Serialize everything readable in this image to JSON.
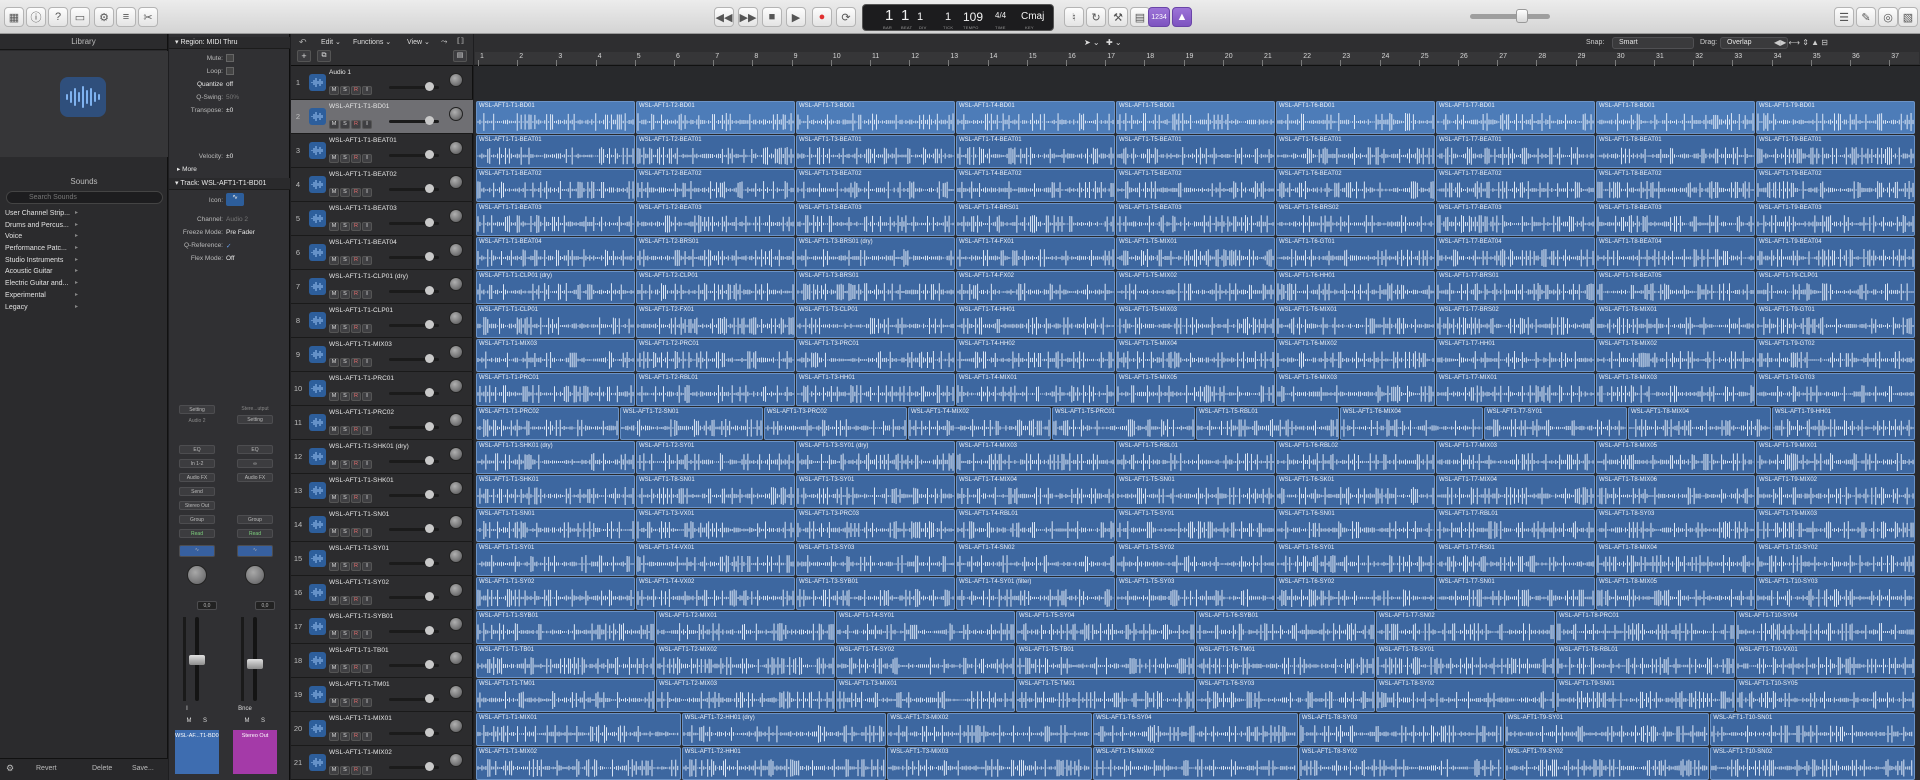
{
  "toolbar": {
    "lcd": {
      "bar": "1",
      "beat": "1",
      "div": "1",
      "tick": "1",
      "bar_lbl": "BAR",
      "beat_lbl": "BEAT",
      "div_lbl": "DIV",
      "tick_lbl": "TICK",
      "tempo": "109",
      "tempo_lbl": "TEMPO",
      "sig": "4/4",
      "sig_lbl": "TIME",
      "key": "Cmaj",
      "key_lbl": "KEY"
    },
    "count_in": "1234"
  },
  "library": {
    "title": "Library",
    "sounds_title": "Sounds",
    "search_placeholder": "Search Sounds",
    "items": [
      "User Channel Strip...",
      "Drums and Percus...",
      "Voice",
      "Performance Patc...",
      "Studio Instruments",
      "Acoustic Guitar",
      "Electric Guitar and...",
      "Experimental",
      "Legacy"
    ],
    "revert": "Revert",
    "delete": "Delete",
    "save": "Save..."
  },
  "inspector": {
    "region_title": "Region: MIDI Thru",
    "mute": "Mute:",
    "loop": "Loop:",
    "quantize": "Quantize",
    "quantize_val": "off",
    "qswing": "Q-Swing:",
    "qswing_val": "50%",
    "transpose": "Transpose:",
    "transpose_val": "±0",
    "velocity": "Velocity:",
    "velocity_val": "±0",
    "more": "More",
    "track_title": "Track:  WSL-AFT1-T1-BD01",
    "icon": "Icon:",
    "channel": "Channel:",
    "channel_val": "Audio 2",
    "freeze": "Freeze Mode:",
    "freeze_val": "Pre Fader",
    "qref": "Q-Reference:",
    "qref_val": "✓",
    "flex": "Flex Mode:",
    "flex_val": "Off",
    "strip1": {
      "setting": "Setting",
      "audio": "Audio 2",
      "eq": "EQ",
      "input": "In 1-2",
      "fx": "Audio FX",
      "send": "Send",
      "out": "Stereo Out",
      "group": "Group",
      "auto": "Read",
      "vol": "0,0",
      "name": "WSL-AF...T1-BD01",
      "btn": "I"
    },
    "strip2": {
      "top": "Stere...utput",
      "setting": "Setting",
      "eq": "EQ",
      "fx": "Audio FX",
      "group": "Group",
      "auto": "Read",
      "vol": "0,0",
      "name": "Stereo Out",
      "btn": "Bnce"
    }
  },
  "arrange": {
    "edit": "Edit",
    "functions": "Functions",
    "view": "View",
    "snap_lbl": "Snap:",
    "snap_val": "Smart",
    "drag_lbl": "Drag:",
    "drag_val": "Overlap",
    "bars": [
      "1",
      "2",
      "3",
      "4",
      "5",
      "6",
      "7",
      "8",
      "9",
      "10",
      "11",
      "12",
      "13",
      "14",
      "15",
      "16",
      "17",
      "18",
      "19",
      "20",
      "21",
      "22",
      "23",
      "24",
      "25",
      "26",
      "27",
      "28",
      "29",
      "30",
      "31",
      "32",
      "33",
      "34",
      "35",
      "36",
      "37"
    ]
  },
  "tracks": [
    {
      "num": "1",
      "name": "Audio 1",
      "regions": []
    },
    {
      "num": "2",
      "name": "WSL-AFT1-T1-BD01",
      "sel": true,
      "regions": [
        "WSL-AFT1-T1-BD01",
        "WSL-AFT1-T2-BD01",
        "WSL-AFT1-T3-BD01",
        "WSL-AFT1-T4-BD01",
        "WSL-AFT1-T5-BD01",
        "WSL-AFT1-T6-BD01",
        "WSL-AFT1-T7-BD01",
        "WSL-AFT1-T8-BD01",
        "WSL-AFT1-T9-BD01"
      ]
    },
    {
      "num": "3",
      "name": "WSL-AFT1-T1-BEAT01",
      "regions": [
        "WSL-AFT1-T1-BEAT01",
        "WSL-AFT1-T2-BEAT01",
        "WSL-AFT1-T3-BEAT01",
        "WSL-AFT1-T4-BEAT01",
        "WSL-AFT1-T5-BEAT01",
        "WSL-AFT1-T6-BEAT01",
        "WSL-AFT1-T7-BEAT01",
        "WSL-AFT1-T8-BEAT01",
        "WSL-AFT1-T9-BEAT01"
      ]
    },
    {
      "num": "4",
      "name": "WSL-AFT1-T1-BEAT02",
      "regions": [
        "WSL-AFT1-T1-BEAT02",
        "WSL-AFT1-T2-BEAT02",
        "WSL-AFT1-T3-BEAT02",
        "WSL-AFT1-T4-BEAT02",
        "WSL-AFT1-T5-BEAT02",
        "WSL-AFT1-T6-BEAT02",
        "WSL-AFT1-T7-BEAT02",
        "WSL-AFT1-T8-BEAT02",
        "WSL-AFT1-T9-BEAT02"
      ]
    },
    {
      "num": "5",
      "name": "WSL-AFT1-T1-BEAT03",
      "regions": [
        "WSL-AFT1-T1-BEAT03",
        "WSL-AFT1-T2-BEAT03",
        "WSL-AFT1-T3-BEAT03",
        "WSL-AFT1-T4-BRS01",
        "WSL-AFT1-T5-BEAT03",
        "WSL-AFT1-T6-BRS02",
        "WSL-AFT1-T7-BEAT03",
        "WSL-AFT1-T8-BEAT03",
        "WSL-AFT1-T9-BEAT03"
      ]
    },
    {
      "num": "6",
      "name": "WSL-AFT1-T1-BEAT04",
      "regions": [
        "WSL-AFT1-T1-BEAT04",
        "WSL-AFT1-T2-BRS01",
        "WSL-AFT1-T3-BRS01 (dry)",
        "WSL-AFT1-T4-FX01",
        "WSL-AFT1-T5-MIX01",
        "WSL-AFT1-T6-GT01",
        "WSL-AFT1-T7-BEAT04",
        "WSL-AFT1-T8-BEAT04",
        "WSL-AFT1-T9-BEAT04"
      ]
    },
    {
      "num": "7",
      "name": "WSL-AFT1-T1-CLP01 (dry)",
      "regions": [
        "WSL-AFT1-T1-CLP01 (dry)",
        "WSL-AFT1-T2-CLP01",
        "WSL-AFT1-T3-BRS01",
        "WSL-AFT1-T4-FX02",
        "WSL-AFT1-T5-MIX02",
        "WSL-AFT1-T6-HH01",
        "WSL-AFT1-T7-BRS01",
        "WSL-AFT1-T8-BEAT05",
        "WSL-AFT1-T9-CLP01"
      ]
    },
    {
      "num": "8",
      "name": "WSL-AFT1-T1-CLP01",
      "regions": [
        "WSL-AFT1-T1-CLP01",
        "WSL-AFT1-T2-FX01",
        "WSL-AFT1-T3-CLP01",
        "WSL-AFT1-T4-HH01",
        "WSL-AFT1-T5-MIX03",
        "WSL-AFT1-T6-MIX01",
        "WSL-AFT1-T7-BRS02",
        "WSL-AFT1-T8-MIX01",
        "WSL-AFT1-T9-GT01"
      ]
    },
    {
      "num": "9",
      "name": "WSL-AFT1-T1-MIX03",
      "regions": [
        "WSL-AFT1-T1-MIX03",
        "WSL-AFT1-T2-PRC01",
        "WSL-AFT1-T3-PRC01",
        "WSL-AFT1-T4-HH02",
        "WSL-AFT1-T5-MIX04",
        "WSL-AFT1-T6-MIX02",
        "WSL-AFT1-T7-HH01",
        "WSL-AFT1-T8-MIX02",
        "WSL-AFT1-T9-GT02"
      ]
    },
    {
      "num": "10",
      "name": "WSL-AFT1-T1-PRC01",
      "regions": [
        "WSL-AFT1-T1-PRC01",
        "WSL-AFT1-T2-RBL01",
        "WSL-AFT1-T3-HH01",
        "WSL-AFT1-T4-MIX01",
        "WSL-AFT1-T5-MIX05",
        "WSL-AFT1-T6-MIX03",
        "WSL-AFT1-T7-MIX01",
        "WSL-AFT1-T8-MIX03",
        "WSL-AFT1-T9-GT03"
      ]
    },
    {
      "num": "11",
      "name": "WSL-AFT1-T1-PRC02",
      "regions": [
        "WSL-AFT1-T1-PRC02",
        "WSL-AFT1-T2-SN01",
        "WSL-AFT1-T3-PRC02",
        "WSL-AFT1-T4-MIX02",
        "WSL-AFT1-T5-PRC01",
        "WSL-AFT1-T5-RBL01",
        "WSL-AFT1-T6-MIX04",
        "WSL-AFT1-T7-SY01",
        "WSL-AFT1-T8-MIX04",
        "WSL-AFT1-T9-HH01"
      ]
    },
    {
      "num": "12",
      "name": "WSL-AFT1-T1-SHK01 (dry)",
      "regions": [
        "WSL-AFT1-T1-SHK01 (dry)",
        "WSL-AFT1-T2-SY01",
        "WSL-AFT1-T3-SY01 (dry)",
        "WSL-AFT1-T4-MIX03",
        "WSL-AFT1-T5-RBL01",
        "WSL-AFT1-T6-RBL02",
        "WSL-AFT1-T7-MIX03",
        "WSL-AFT1-T8-MIX05",
        "WSL-AFT1-T9-MIX01"
      ]
    },
    {
      "num": "13",
      "name": "WSL-AFT1-T1-SHK01",
      "regions": [
        "WSL-AFT1-T1-SHK01",
        "WSL-AFT1-T8-SN01",
        "WSL-AFT1-T3-SY01",
        "WSL-AFT1-T4-MIX04",
        "WSL-AFT1-T5-SN01",
        "WSL-AFT1-T6-SK01",
        "WSL-AFT1-T7-MIX04",
        "WSL-AFT1-T8-MIX06",
        "WSL-AFT1-T9-MIX02"
      ]
    },
    {
      "num": "14",
      "name": "WSL-AFT1-T1-SN01",
      "regions": [
        "WSL-AFT1-T1-SN01",
        "WSL-AFT1-T3-VX01",
        "WSL-AFT1-T3-PRC03",
        "WSL-AFT1-T4-RBL01",
        "WSL-AFT1-T5-SY01",
        "WSL-AFT1-T6-SN01",
        "WSL-AFT1-T7-RBL01",
        "WSL-AFT1-T8-SY03",
        "WSL-AFT1-T9-MIX03"
      ]
    },
    {
      "num": "15",
      "name": "WSL-AFT1-T1-SY01",
      "regions": [
        "WSL-AFT1-T1-SY01",
        "WSL-AFT1-T4-VX01",
        "WSL-AFT1-T3-SY03",
        "WSL-AFT1-T4-SN02",
        "WSL-AFT1-T5-SY02",
        "WSL-AFT1-T6-SY01",
        "WSL-AFT1-T7-RS01",
        "WSL-AFT1-T8-MIX04",
        "WSL-AFT1-T10-SY02"
      ]
    },
    {
      "num": "16",
      "name": "WSL-AFT1-T1-SY02",
      "regions": [
        "WSL-AFT1-T1-SY02",
        "WSL-AFT1-T4-VX02",
        "WSL-AFT1-T3-SYB01",
        "WSL-AFT1-T4-SY01 (filter)",
        "WSL-AFT1-T5-SY03",
        "WSL-AFT1-T6-SY02",
        "WSL-AFT1-T7-SN01",
        "WSL-AFT1-T8-MIX05",
        "WSL-AFT1-T10-SY03"
      ]
    },
    {
      "num": "17",
      "name": "WSL-AFT1-T1-SYB01",
      "regions": [
        "WSL-AFT1-T1-SYB01",
        "WSL-AFT1-T2-MIX01",
        "WSL-AFT1-T4-SY01",
        "WSL-AFT1-T5-SY04",
        "WSL-AFT1-T6-SYB01",
        "WSL-AFT1-T7-SN02",
        "WSL-AFT1-T8-PRC01",
        "WSL-AFT1-T10-SY04"
      ]
    },
    {
      "num": "18",
      "name": "WSL-AFT1-T1-TB01",
      "regions": [
        "WSL-AFT1-T1-TB01",
        "WSL-AFT1-T2-MIX02",
        "WSL-AFT1-T4-SY02",
        "WSL-AFT1-T5-TB01",
        "WSL-AFT1-T6-TM01",
        "WSL-AFT1-T8-SY01",
        "WSL-AFT1-T8-RBL01",
        "WSL-AFT1-T10-VX01"
      ]
    },
    {
      "num": "19",
      "name": "WSL-AFT1-T1-TM01",
      "regions": [
        "WSL-AFT1-T1-TM01",
        "WSL-AFT1-T2-MIX03",
        "WSL-AFT1-T3-MIX01",
        "WSL-AFT1-T5-TM01",
        "WSL-AFT1-T6-SY03",
        "WSL-AFT1-T8-SY02",
        "WSL-AFT1-T9-SN01",
        "WSL-AFT1-T10-SY05"
      ]
    },
    {
      "num": "20",
      "name": "WSL-AFT1-T1-MIX01",
      "regions": [
        "WSL-AFT1-T1-MIX01",
        "WSL-AFT1-T2-HH01 (dry)",
        "WSL-AFT1-T3-MIX02",
        "WSL-AFT1-T6-SY04",
        "WSL-AFT1-T8-SY03",
        "WSL-AFT1-T9-SY01",
        "WSL-AFT1-T10-SN01"
      ]
    },
    {
      "num": "21",
      "name": "WSL-AFT1-T1-MIX02",
      "regions": [
        "WSL-AFT1-T1-MIX02",
        "WSL-AFT1-T2-HH01",
        "WSL-AFT1-T3-MIX03",
        "WSL-AFT1-T6-MIX02",
        "WSL-AFT1-T8-SY02",
        "WSL-AFT1-T9-SY02",
        "WSL-AFT1-T10-SN02"
      ]
    }
  ]
}
